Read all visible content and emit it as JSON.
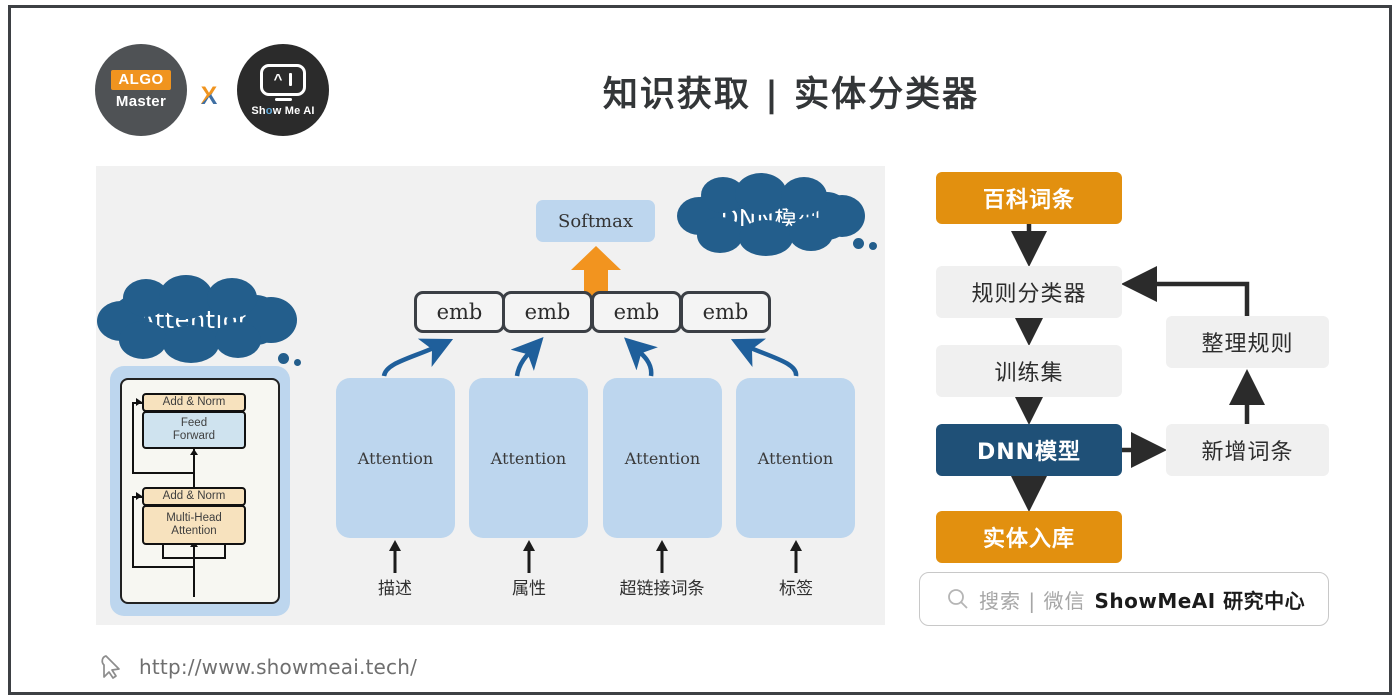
{
  "page": {
    "title": "知识获取 | 实体分类器",
    "background": "#ffffff",
    "frame_color": "#3d4044"
  },
  "logos": {
    "algo": {
      "tag": "ALGO",
      "name": "Master",
      "circle_color": "#4f5255",
      "tag_color": "#f0941f"
    },
    "separator": "X",
    "showmeai": {
      "name_prefix": "Sh",
      "name_dot": "o",
      "name_suffix": "w Me AI",
      "circle_color": "#2b2b2b",
      "icon": "robot-face-icon"
    }
  },
  "left_panel": {
    "background": "#f1f1f1",
    "callouts": [
      {
        "id": "attention",
        "text": "Attention",
        "color": "#235e8c"
      },
      {
        "id": "dnn",
        "text": "DNN模型",
        "color": "#235e8c"
      }
    ],
    "softmax": {
      "label": "Softmax",
      "color": "#bdd6ee"
    },
    "arrow_color": "#f2941f",
    "transformer": {
      "outer_color": "#bdd6ee",
      "inner_color": "#f7f7f2",
      "blocks": [
        {
          "label": "Add & Norm",
          "color": "#f7e2be"
        },
        {
          "label": "Feed\nForward",
          "line1": "Feed",
          "line2": "Forward",
          "color": "#cfe3ef"
        },
        {
          "label": "Add & Norm",
          "color": "#f7e2be"
        },
        {
          "label": "Multi-Head\nAttention",
          "line1": "Multi-Head",
          "line2": "Attention",
          "color": "#f7e2be"
        }
      ]
    },
    "emb_boxes": [
      {
        "label": "emb"
      },
      {
        "label": "emb"
      },
      {
        "label": "emb"
      },
      {
        "label": "emb"
      }
    ],
    "attention_columns": [
      {
        "label": "Attention",
        "input": "描述"
      },
      {
        "label": "Attention",
        "input": "属性"
      },
      {
        "label": "Attention",
        "input": "超链接词条"
      },
      {
        "label": "Attention",
        "input": "标签"
      }
    ],
    "column_color": "#bdd6ee"
  },
  "flowchart": {
    "nodes": [
      {
        "id": "baike",
        "label": "百科词条",
        "style": "orange"
      },
      {
        "id": "rule",
        "label": "规则分类器",
        "style": "gray"
      },
      {
        "id": "train",
        "label": "训练集",
        "style": "gray"
      },
      {
        "id": "dnn",
        "label": "DNN模型",
        "style": "navy"
      },
      {
        "id": "entity",
        "label": "实体入库",
        "style": "orange"
      },
      {
        "id": "rules",
        "label": "整理规则",
        "style": "gray"
      },
      {
        "id": "newword",
        "label": "新增词条",
        "style": "gray"
      }
    ],
    "colors": {
      "orange": "#e2900f",
      "navy": "#1f5077",
      "gray": "#f0f0f0",
      "arrow": "#2b2b2b"
    },
    "edges": [
      {
        "from": "baike",
        "to": "rule"
      },
      {
        "from": "rule",
        "to": "train"
      },
      {
        "from": "train",
        "to": "dnn"
      },
      {
        "from": "dnn",
        "to": "entity"
      },
      {
        "from": "dnn",
        "to": "newword"
      },
      {
        "from": "newword",
        "to": "rules"
      },
      {
        "from": "rules",
        "to": "rule"
      }
    ]
  },
  "search": {
    "icon": "search-icon",
    "placeholder": "搜索 | 微信",
    "brand": "ShowMeAI 研究中心"
  },
  "footer": {
    "icon": "cursor-icon",
    "url": "http://www.showmeai.tech/"
  }
}
